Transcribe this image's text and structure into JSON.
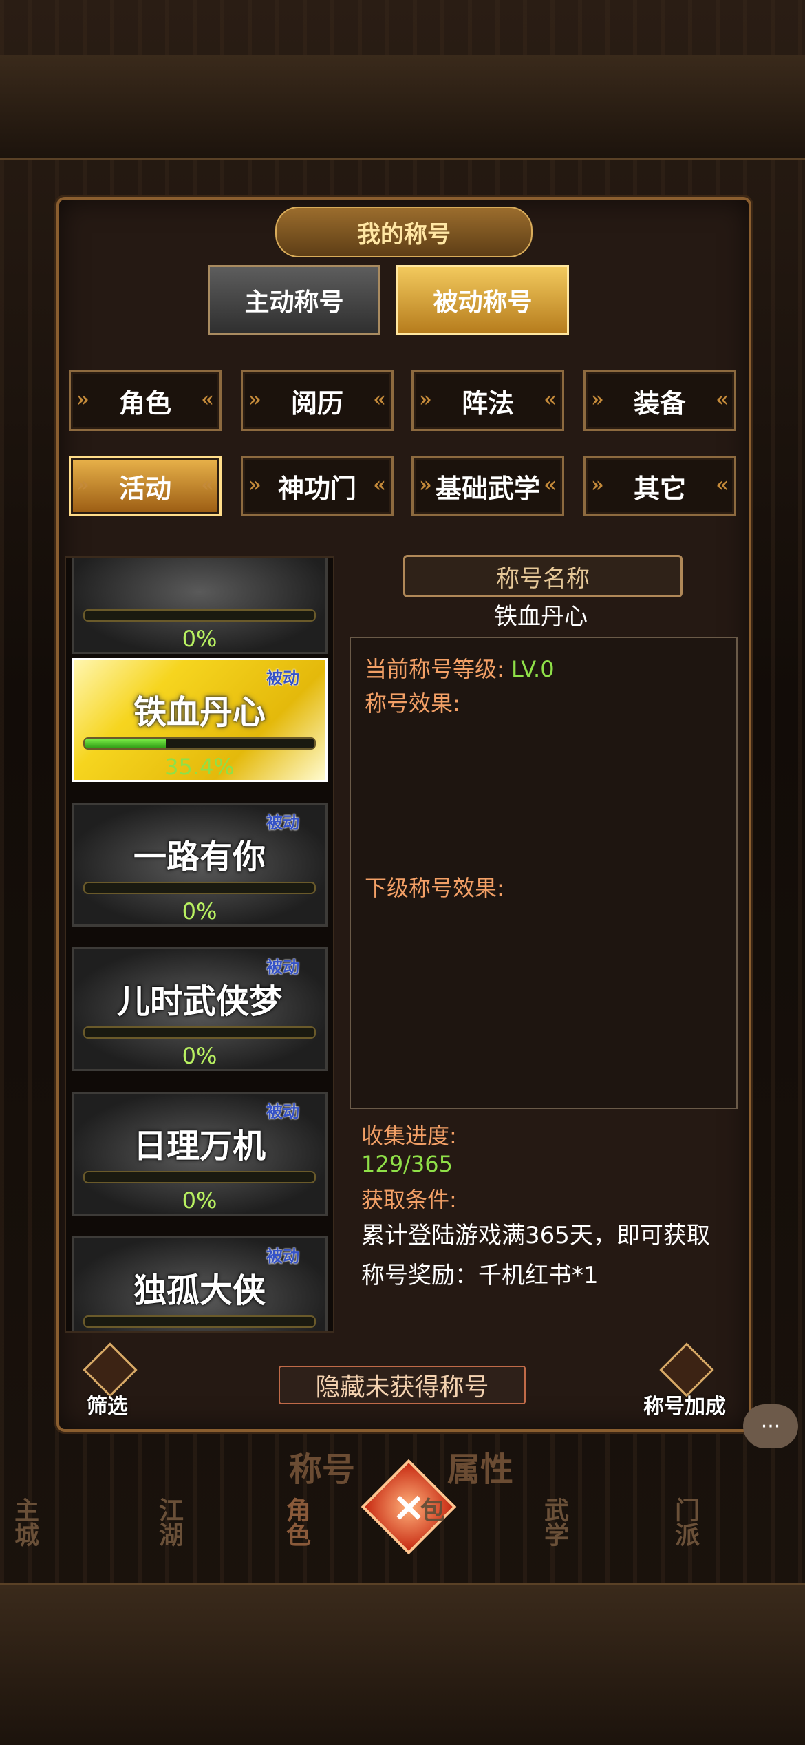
{
  "header": {
    "title": "我的称号"
  },
  "tabs": {
    "active_title": "主动称号",
    "passive_title": "被动称号"
  },
  "categories": [
    "角色",
    "阅历",
    "阵法",
    "装备",
    "活动",
    "神功门",
    "基础武学",
    "其它"
  ],
  "list": {
    "items": [
      {
        "name": "",
        "badge": "",
        "progress": 0,
        "pct": "0%"
      },
      {
        "name": "铁血丹心",
        "badge": "被动",
        "progress": 35.4,
        "pct": "35.4%"
      },
      {
        "name": "一路有你",
        "badge": "被动",
        "progress": 0,
        "pct": "0%"
      },
      {
        "name": "儿时武侠梦",
        "badge": "被动",
        "progress": 0,
        "pct": "0%"
      },
      {
        "name": "日理万机",
        "badge": "被动",
        "progress": 0,
        "pct": "0%"
      },
      {
        "name": "独孤大侠",
        "badge": "被动",
        "progress": 0,
        "pct": ""
      }
    ]
  },
  "detail": {
    "name_label": "称号名称",
    "selected_name": "铁血丹心",
    "level_label": "当前称号等级:",
    "level_value": "LV.0",
    "effect_label": "称号效果:",
    "next_effect_label": "下级称号效果:",
    "collect_label": "收集进度:",
    "collect_value": "129/365",
    "condition_label": "获取条件:",
    "condition_text": "累计登陆游戏满365天，即可获取称号奖励：千机红书*1"
  },
  "bottom": {
    "filter_label": "筛选",
    "hide_label": "隐藏未获得称号",
    "bonus_label": "称号加成"
  },
  "nav": {
    "tab_title": "称号",
    "tab_attr": "属性",
    "items": [
      "主城",
      "江湖",
      "角色",
      "包",
      "武学",
      "门派"
    ]
  }
}
